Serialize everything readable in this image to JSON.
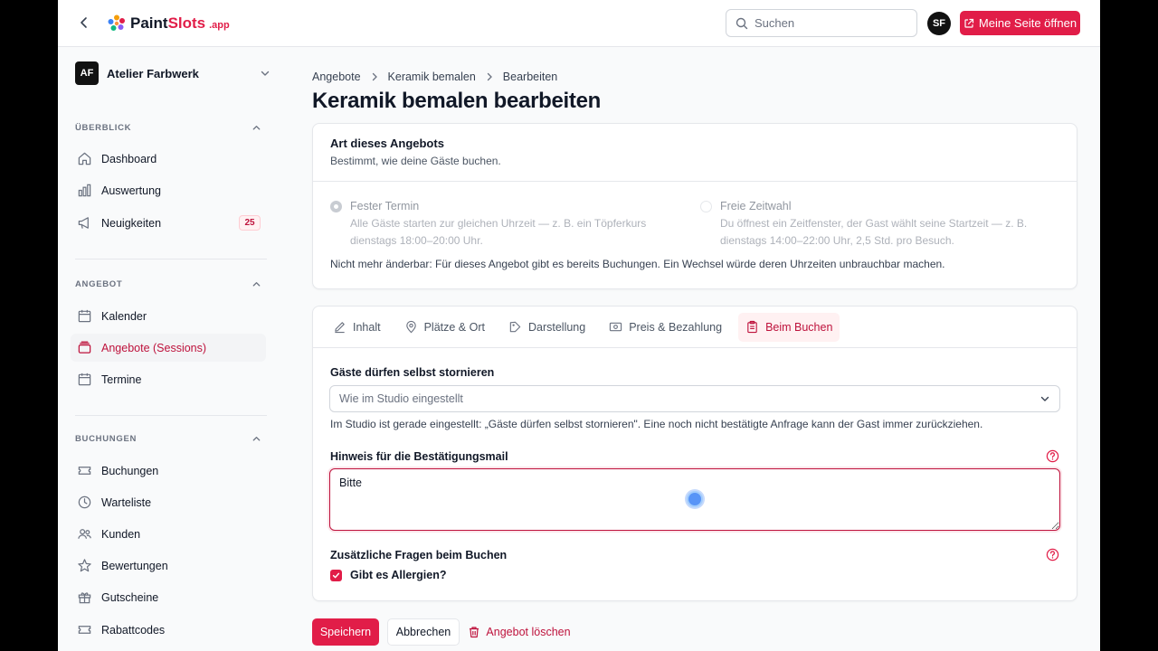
{
  "topbar": {
    "logo_main": "Paint",
    "logo_brand": "Slots",
    "logo_suffix": ".app",
    "search_placeholder": "Suchen",
    "avatar_initials": "SF",
    "open_page_label": "Meine Seite öffnen"
  },
  "sidebar": {
    "workspace_initials": "AF",
    "workspace_name": "Atelier Farbwerk",
    "sections": [
      {
        "title": "ÜBERBLICK",
        "items": [
          {
            "label": "Dashboard",
            "icon": "home-icon"
          },
          {
            "label": "Auswertung",
            "icon": "bar-chart-icon"
          },
          {
            "label": "Neuigkeiten",
            "icon": "megaphone-icon",
            "badge": "25"
          }
        ]
      },
      {
        "title": "ANGEBOT",
        "items": [
          {
            "label": "Kalender",
            "icon": "calendar-icon"
          },
          {
            "label": "Angebote (Sessions)",
            "icon": "layers-icon",
            "active": true
          },
          {
            "label": "Termine",
            "icon": "calendar-icon"
          }
        ]
      },
      {
        "title": "BUCHUNGEN",
        "items": [
          {
            "label": "Buchungen",
            "icon": "ticket-icon"
          },
          {
            "label": "Warteliste",
            "icon": "clock-icon"
          },
          {
            "label": "Kunden",
            "icon": "users-icon"
          },
          {
            "label": "Bewertungen",
            "icon": "star-icon"
          },
          {
            "label": "Gutscheine",
            "icon": "gift-icon"
          },
          {
            "label": "Rabattcodes",
            "icon": "ticket-icon"
          }
        ]
      }
    ]
  },
  "breadcrumb": [
    "Angebote",
    "Keramik bemalen",
    "Bearbeiten"
  ],
  "page_title": "Keramik bemalen bearbeiten",
  "offer_type": {
    "title": "Art dieses Angebots",
    "subtitle": "Bestimmt, wie deine Gäste buchen.",
    "options": [
      {
        "label": "Fester Termin",
        "desc_line1": "Alle Gäste starten zur gleichen Uhrzeit — z. B. ein Töpferkurs",
        "desc_line2": "dienstags 18:00–20:00 Uhr.",
        "selected": true
      },
      {
        "label": "Freie Zeitwahl",
        "desc_line1": "Du öffnest ein Zeitfenster, der Gast wählt seine Startzeit — z. B.",
        "desc_line2": "dienstags 14:00–22:00 Uhr, 2,5 Std. pro Besuch.",
        "selected": false
      }
    ],
    "note": "Nicht mehr änderbar: Für dieses Angebot gibt es bereits Buchungen. Ein Wechsel würde deren Uhrzeiten unbrauchbar machen."
  },
  "tabs": [
    {
      "label": "Inhalt",
      "icon": "edit-icon"
    },
    {
      "label": "Plätze & Ort",
      "icon": "map-pin-icon"
    },
    {
      "label": "Darstellung",
      "icon": "palette-icon"
    },
    {
      "label": "Preis & Bezahlung",
      "icon": "payment-icon"
    },
    {
      "label": "Beim Buchen",
      "icon": "clipboard-icon",
      "active": true
    }
  ],
  "form": {
    "cancel_label": "Gäste dürfen selbst stornieren",
    "cancel_select_value": "Wie im Studio eingestellt",
    "cancel_helper": "Im Studio ist gerade eingestellt: „Gäste dürfen selbst stornieren\". Eine noch nicht bestätigte Anfrage kann der Gast immer zurückziehen.",
    "note_label": "Hinweis für die Bestätigungsmail",
    "note_value": "Bitte",
    "questions_label": "Zusätzliche Fragen beim Buchen",
    "question_1": "Gibt es Allergien?"
  },
  "actions": {
    "save": "Speichern",
    "cancel": "Abbrechen",
    "delete": "Angebot löschen"
  },
  "colors": {
    "accent": "#e11d48",
    "accent_dark": "#be123c"
  }
}
